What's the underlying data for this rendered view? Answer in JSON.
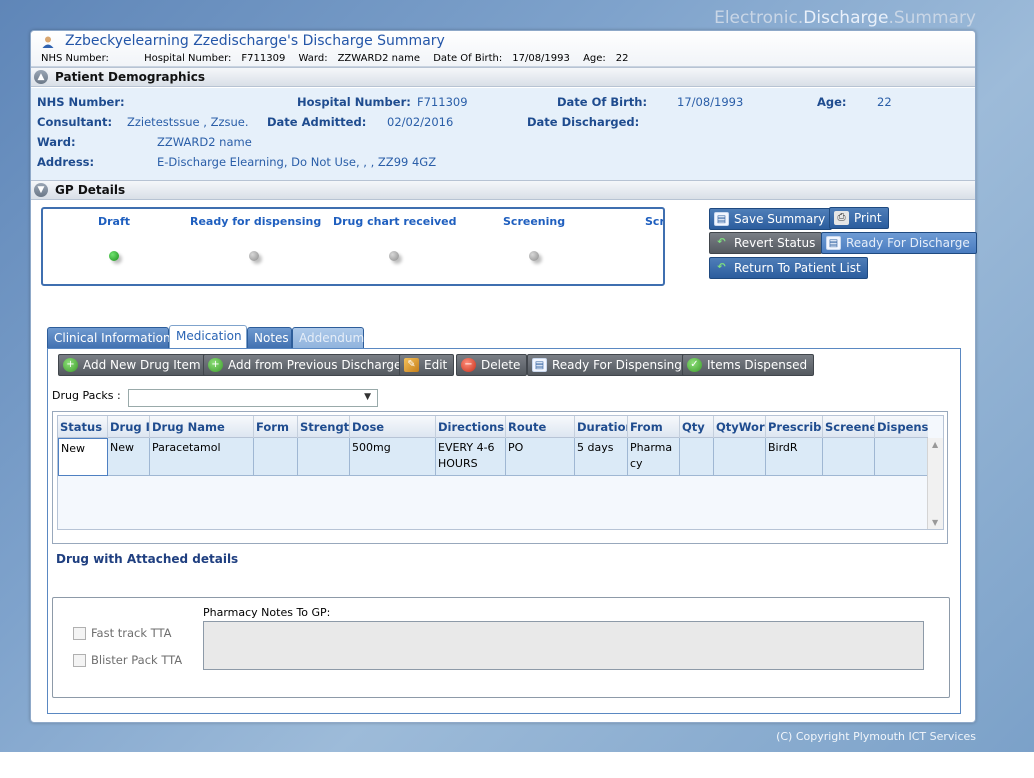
{
  "brand": {
    "part1": "Electronic.",
    "part2": "Discharge",
    "part3": ".Summary"
  },
  "header": {
    "title": "Zzbeckyelearning Zzedischarge's Discharge Summary",
    "nhs_label": "NHS Number:",
    "nhs_value": "",
    "hosp_label": "Hospital Number:",
    "hosp_value": "F711309",
    "ward_label": "Ward:",
    "ward_value": "ZZWARD2 name",
    "dob_label": "Date Of Birth:",
    "dob_value": "17/08/1993",
    "age_label": "Age:",
    "age_value": "22"
  },
  "demographics": {
    "section_title": "Patient Demographics",
    "nhs_label": "NHS Number:",
    "nhs_value": "",
    "hosp_label": "Hospital Number:",
    "hosp_value": "F711309",
    "dob_label": "Date Of Birth:",
    "dob_value": "17/08/1993",
    "age_label": "Age:",
    "age_value": "22",
    "consultant_label": "Consultant:",
    "consultant_value": "Zzietestssue , Zzsue.",
    "admitted_label": "Date Admitted:",
    "admitted_value": "02/02/2016",
    "discharged_label": "Date Discharged:",
    "discharged_value": "",
    "ward_label": "Ward:",
    "ward_value": "ZZWARD2 name",
    "address_label": "Address:",
    "address_value": "E-Discharge Elearning, Do Not Use, , , ZZ99 4GZ"
  },
  "gp_details": {
    "section_title": "GP Details",
    "steps": [
      {
        "label": "Draft",
        "state": "current"
      },
      {
        "label": "Ready for dispensing",
        "state": "pending"
      },
      {
        "label": "Drug chart received",
        "state": "pending"
      },
      {
        "label": "Screening",
        "state": "pending"
      },
      {
        "label": "Scr",
        "state": "pending"
      }
    ]
  },
  "actions": {
    "save_summary": "Save Summary",
    "print": "Print",
    "revert_status": "Revert Status",
    "ready_for_discharge": "Ready For Discharge",
    "return_to_list": "Return To Patient List"
  },
  "tabs": [
    {
      "label": "Clinical Information",
      "state": "normal"
    },
    {
      "label": "Medication",
      "state": "active"
    },
    {
      "label": "Notes",
      "state": "normal"
    },
    {
      "label": "Addendum",
      "state": "disabled"
    }
  ],
  "medication": {
    "toolbar": {
      "add_new": "Add New Drug Item",
      "add_previous": "Add from Previous Discharge",
      "edit": "Edit",
      "delete": "Delete",
      "ready_dispensing": "Ready For Dispensing",
      "items_dispensed": "Items Dispensed"
    },
    "drug_packs_label": "Drug Packs :",
    "drug_packs_value": "",
    "columns": [
      "Status",
      "Drug I",
      "Drug Name",
      "Form",
      "Strengtl",
      "Dose",
      "Directions",
      "Route",
      "Duratior",
      "From",
      "Qty",
      "QtyWor",
      "Prescribe",
      "Screene",
      "Dispens"
    ],
    "rows": [
      {
        "status": "New",
        "drug_i": "New",
        "drug_name": "Paracetamol",
        "form": "",
        "strength": "",
        "dose": "500mg",
        "directions": "EVERY 4-6 HOURS",
        "route": "PO",
        "duration": "5 days",
        "from": "Pharmacy",
        "qty": "",
        "qty_words": "",
        "prescriber": "BirdR",
        "screener": "",
        "dispenser": ""
      }
    ],
    "attached_label": "Drug with Attached details",
    "fast_track_label": "Fast track TTA",
    "blister_pack_label": "Blister Pack TTA",
    "pharmacy_notes_label": "Pharmacy Notes To GP:",
    "pharmacy_notes_value": ""
  },
  "footer": {
    "copyright": "(C) Copyright Plymouth ICT Services"
  }
}
